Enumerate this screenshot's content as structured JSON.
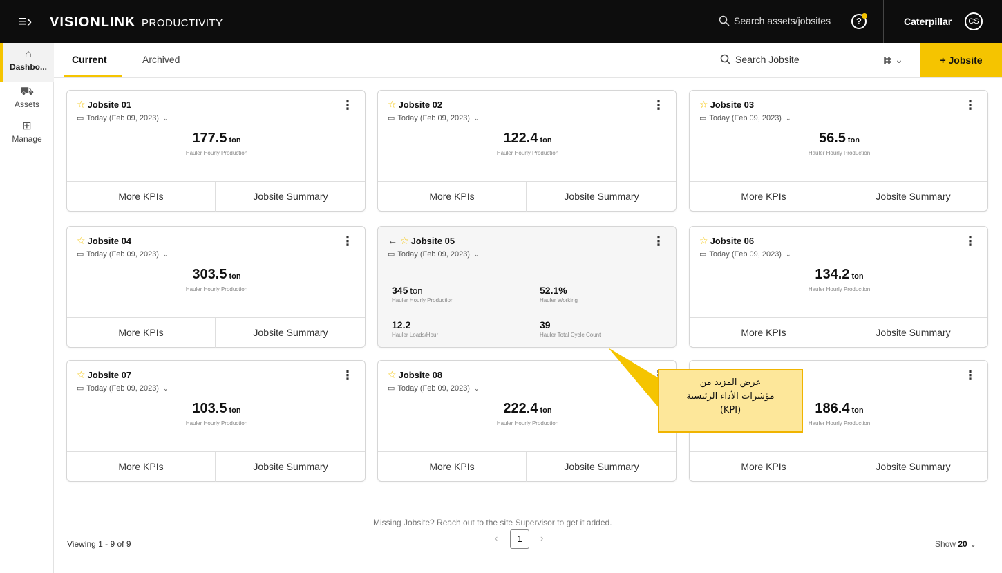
{
  "header": {
    "brand": "VISIONLINK",
    "brand_sub": "PRODUCTIVITY",
    "search_label": "Search assets/jobsites",
    "user_name": "Caterpillar",
    "user_initials": "CS"
  },
  "sidebar": {
    "items": [
      {
        "label": "Dashbo...",
        "icon": "home-icon"
      },
      {
        "label": "Assets",
        "icon": "assets-icon"
      },
      {
        "label": "Manage",
        "icon": "manage-icon"
      }
    ]
  },
  "tabs": {
    "current": "Current",
    "archived": "Archived",
    "search_label": "Search Jobsite",
    "add_button": "+ Jobsite"
  },
  "cards": [
    {
      "title": "Jobsite 01",
      "date": "Today (Feb 09, 2023)",
      "value": "177.5",
      "unit": "ton",
      "label": "Hauler Hourly Production"
    },
    {
      "title": "Jobsite 02",
      "date": "Today (Feb 09, 2023)",
      "value": "122.4",
      "unit": "ton",
      "label": "Hauler Hourly Production"
    },
    {
      "title": "Jobsite 03",
      "date": "Today (Feb 09, 2023)",
      "value": "56.5",
      "unit": "ton",
      "label": "Hauler Hourly Production"
    },
    {
      "title": "Jobsite 04",
      "date": "Today (Feb 09, 2023)",
      "value": "303.5",
      "unit": "ton",
      "label": "Hauler Hourly Production"
    },
    {
      "title": "Jobsite 05",
      "date": "Today (Feb 09, 2023)",
      "kpis": [
        {
          "value": "345",
          "unit": "ton",
          "label": "Hauler Hourly Production"
        },
        {
          "value": "52.1%",
          "unit": "",
          "label": "Hauler Working"
        },
        {
          "value": "12.2",
          "unit": "",
          "label": "Hauler Loads/Hour"
        },
        {
          "value": "39",
          "unit": "",
          "label": "Hauler Total Cycle Count"
        }
      ]
    },
    {
      "title": "Jobsite 06",
      "date": "Today (Feb 09, 2023)",
      "value": "134.2",
      "unit": "ton",
      "label": "Hauler Hourly Production"
    },
    {
      "title": "Jobsite 07",
      "date": "Today (Feb 09, 2023)",
      "value": "103.5",
      "unit": "ton",
      "label": "Hauler Hourly Production"
    },
    {
      "title": "Jobsite 08",
      "date": "Today (Feb 09, 2023)",
      "value": "222.4",
      "unit": "ton",
      "label": "Hauler Hourly Production"
    },
    {
      "title": "",
      "date": "",
      "value": "186.4",
      "unit": "ton",
      "label": "Hauler Hourly Production"
    }
  ],
  "card_buttons": {
    "more": "More KPIs",
    "summary": "Jobsite Summary"
  },
  "callout": {
    "line1": "عرض المزيد من",
    "line2": "مؤشرات الأداء الرئيسية",
    "line3": "(KPI)"
  },
  "footer": {
    "missing": "Missing Jobsite? Reach out to the site Supervisor to get it added.",
    "viewing": "Viewing 1 - 9 of 9",
    "page": "1",
    "show_label": "Show",
    "show_value": "20"
  },
  "colors": {
    "accent": "#f5c400",
    "topbar": "#0d0d0d"
  }
}
